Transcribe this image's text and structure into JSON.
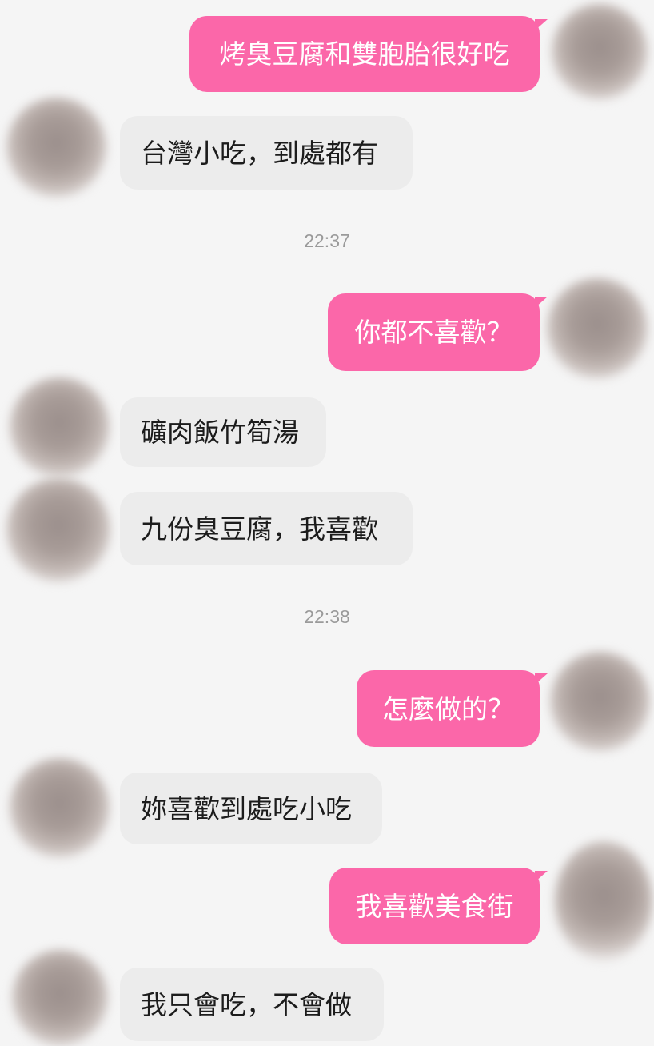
{
  "conversation": {
    "messages": [
      {
        "side": "sent",
        "text": "烤臭豆腐和雙胞胎很好吃"
      },
      {
        "side": "received",
        "text": "台灣小吃，到處都有"
      },
      {
        "side": "sent",
        "text": "你都不喜歡？"
      },
      {
        "side": "received",
        "text": "礦肉飯竹筍湯"
      },
      {
        "side": "received",
        "text": "九份臭豆腐，我喜歡"
      },
      {
        "side": "sent",
        "text": "怎麼做的？"
      },
      {
        "side": "received",
        "text": "妳喜歡到處吃小吃"
      },
      {
        "side": "sent",
        "text": "我喜歡美食街"
      },
      {
        "side": "received",
        "text": "我只會吃，不會做"
      }
    ],
    "timestamps": [
      "22:37",
      "22:38"
    ]
  },
  "colors": {
    "background": "#f5f5f5",
    "sent_bubble": "#fb67a9",
    "received_bubble": "#ececec",
    "timestamp_text": "#9a9a9a"
  }
}
